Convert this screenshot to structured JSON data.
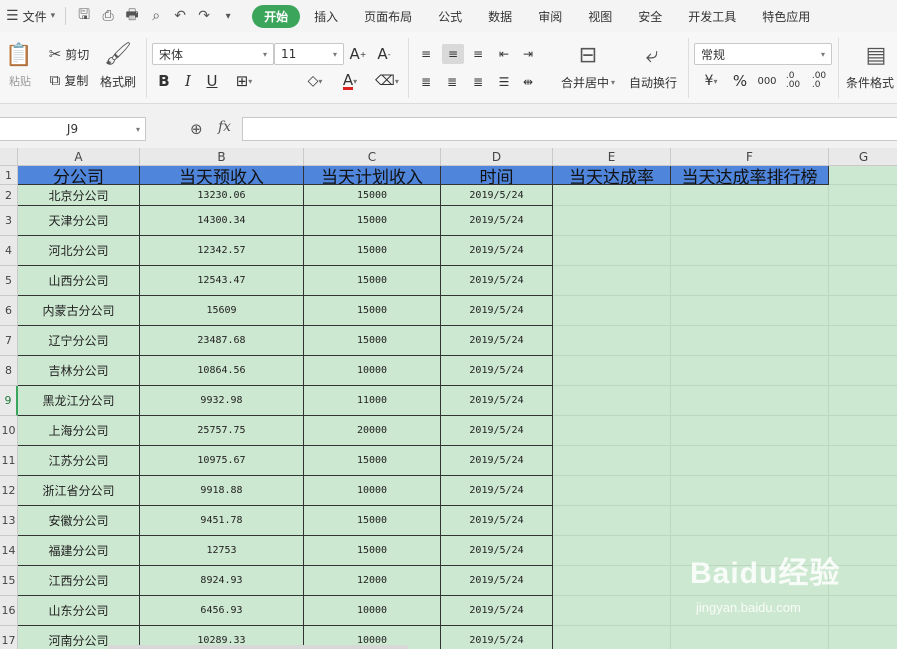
{
  "menubar": {
    "file_label": "文件",
    "tabs": [
      {
        "label": "开始",
        "active": true
      },
      {
        "label": "插入"
      },
      {
        "label": "页面布局"
      },
      {
        "label": "公式"
      },
      {
        "label": "数据"
      },
      {
        "label": "审阅"
      },
      {
        "label": "视图"
      },
      {
        "label": "安全"
      },
      {
        "label": "开发工具"
      },
      {
        "label": "特色应用"
      }
    ]
  },
  "ribbon": {
    "paste_label": "粘贴",
    "cut_label": "剪切",
    "copy_label": "复制",
    "format_painter_label": "格式刷",
    "font_name": "宋体",
    "font_size": "11",
    "merge_center_label": "合并居中",
    "wrap_text_label": "自动换行",
    "number_format": "常规",
    "conditional_format_label": "条件格式"
  },
  "formula_bar": {
    "name_box": "J9",
    "fx_label": "fx",
    "formula": ""
  },
  "grid": {
    "columns": [
      "A",
      "B",
      "C",
      "D",
      "E",
      "F",
      "G"
    ],
    "header_row": [
      "分公司",
      "当天预收入",
      "当天计划收入",
      "时间",
      "当天达成率",
      "当天达成率排行榜"
    ],
    "rows": [
      [
        "北京分公司",
        "13230.06",
        "15000",
        "2019/5/24"
      ],
      [
        "天津分公司",
        "14300.34",
        "15000",
        "2019/5/24"
      ],
      [
        "河北分公司",
        "12342.57",
        "15000",
        "2019/5/24"
      ],
      [
        "山西分公司",
        "12543.47",
        "15000",
        "2019/5/24"
      ],
      [
        "内蒙古分公司",
        "15609",
        "15000",
        "2019/5/24"
      ],
      [
        "辽宁分公司",
        "23487.68",
        "15000",
        "2019/5/24"
      ],
      [
        "吉林分公司",
        "10864.56",
        "10000",
        "2019/5/24"
      ],
      [
        "黑龙江分公司",
        "9932.98",
        "11000",
        "2019/5/24"
      ],
      [
        "上海分公司",
        "25757.75",
        "20000",
        "2019/5/24"
      ],
      [
        "江苏分公司",
        "10975.67",
        "15000",
        "2019/5/24"
      ],
      [
        "浙江省分公司",
        "9918.88",
        "10000",
        "2019/5/24"
      ],
      [
        "安徽分公司",
        "9451.78",
        "15000",
        "2019/5/24"
      ],
      [
        "福建分公司",
        "12753",
        "15000",
        "2019/5/24"
      ],
      [
        "江西分公司",
        "8924.93",
        "12000",
        "2019/5/24"
      ],
      [
        "山东分公司",
        "6456.93",
        "10000",
        "2019/5/24"
      ],
      [
        "河南分公司",
        "10289.33",
        "10000",
        "2019/5/24"
      ]
    ]
  },
  "watermark": {
    "brand": "Baidu经验",
    "url": "jingyan.baidu.com"
  },
  "colors": {
    "accent": "#3ca55c",
    "header_fill": "#4f86db",
    "sheet_bg": "#cde8d1"
  }
}
